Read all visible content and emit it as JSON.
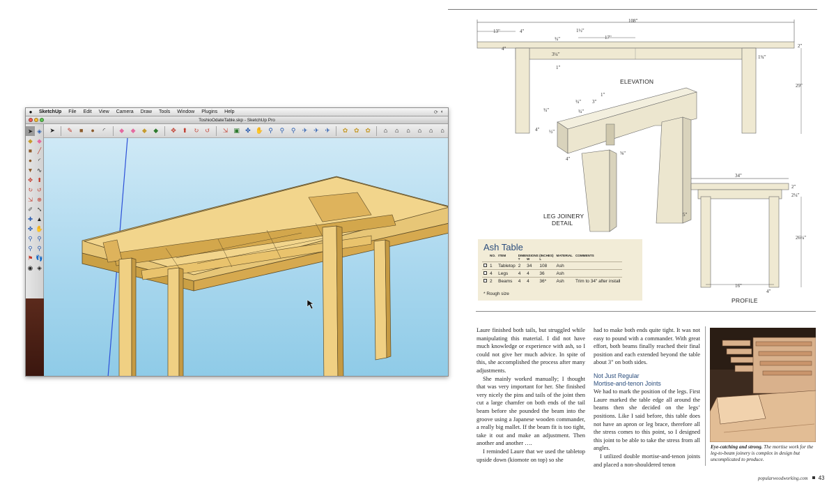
{
  "sketchup": {
    "menubar": {
      "apple": "",
      "items": [
        "SketchUp",
        "File",
        "Edit",
        "View",
        "Camera",
        "Draw",
        "Tools",
        "Window",
        "Plugins",
        "Help"
      ]
    },
    "window_title": "ToshioOdateTable.skp - SketchUp Pro",
    "traffic_lights": [
      "#ec5f57",
      "#f5be3a",
      "#5fc453"
    ],
    "toolbar_icons": [
      "select-arrow-icon",
      "pencil-icon",
      "rectangle-icon",
      "circle-icon",
      "arc-icon",
      "eraser-icon",
      "paint-bucket-icon",
      "tape-icon",
      "move-icon",
      "rotate-icon",
      "scale-icon",
      "push-pull-icon",
      "offset-icon",
      "follow-me-icon",
      "orbit-icon",
      "pan-icon",
      "zoom-icon",
      "zoom-window-icon",
      "zoom-extents-icon",
      "previous-view-icon",
      "next-view-icon",
      "position-camera-icon",
      "walk-icon",
      "look-around-icon",
      "section-plane-icon",
      "component-icon",
      "materials-icon",
      "views-icon"
    ],
    "palette_icons": [
      "select-icon",
      "component-icon",
      "paint-icon",
      "eraser-icon",
      "rectangle-icon",
      "line-icon",
      "circle-icon",
      "arc-icon",
      "polygon-icon",
      "freehand-icon",
      "move-icon",
      "push-pull-icon",
      "rotate-icon",
      "follow-me-icon",
      "scale-icon",
      "offset-icon",
      "tape-icon",
      "dimension-icon",
      "protractor-icon",
      "text-icon",
      "axes-icon",
      "3d-text-icon",
      "orbit-icon",
      "pan-icon",
      "zoom-icon",
      "zoom-window-icon",
      "zoom-extents-icon",
      "previous-icon",
      "position-camera-icon",
      "walk-icon",
      "look-around-icon",
      "section-icon"
    ]
  },
  "drawing": {
    "elevation": {
      "label": "ELEVATION",
      "dims": {
        "overall": "108\"",
        "d13": "13\"",
        "d4": "4\"",
        "d1_1_2": "1½\"",
        "d17": "17\"",
        "d3_4": "¾\"",
        "d3_1_4": "3¼\"",
        "d1": "1\"",
        "d4b": "4\"",
        "d2": "2\"",
        "d1_3_4": "1¾\"",
        "d29": "29\""
      }
    },
    "detail": {
      "label_line1": "LEG JOINERY",
      "label_line2": "DETAIL",
      "dims": {
        "d3_4a": "¾\"",
        "d1": "1\"",
        "d3_4b": "¾\"",
        "d3": "3\"",
        "d3_4c": "¾\"",
        "d4a": "4\"",
        "d1_2": "½\"",
        "d4b": "4\"",
        "d5_8": "⅝\""
      }
    },
    "profile": {
      "label": "PROFILE",
      "dims": {
        "d34": "34\"",
        "d2": "2\"",
        "d2_1_4": "2¼\"",
        "d5": "5\"",
        "d26_1_4": "26¼\"",
        "d16": "16\"",
        "d4": "4\""
      }
    }
  },
  "cutlist": {
    "title": "Ash Table",
    "headers": {
      "no": "NO.",
      "item": "ITEM",
      "dims": "DIMENSIONS (INCHES)",
      "material": "MATERIAL",
      "comments": "COMMENTS",
      "t": "T",
      "w": "W",
      "l": "L"
    },
    "rows": [
      {
        "no": "1",
        "item": "Tabletop",
        "t": "2",
        "w": "34",
        "l": "108",
        "material": "Ash",
        "comments": ""
      },
      {
        "no": "4",
        "item": "Legs",
        "t": "4",
        "w": "4",
        "l": "36",
        "material": "Ash",
        "comments": ""
      },
      {
        "no": "2",
        "item": "Beams",
        "t": "4",
        "w": "4",
        "l": "36*",
        "material": "Ash",
        "comments": "Trim to 34\" after install"
      }
    ],
    "footnote": "* Rough size"
  },
  "article": {
    "col1": [
      "Laure finished both tails, but struggled while manipulating this material. I did not have much knowledge or experience with ash, so I could not give her much advice. In spite of this, she accomplished the process after many adjustments.",
      "She mainly worked manually; I thought that was very important for her. She finished very nicely the pins and tails of the joint then cut a large chamfer on both ends of the tail beam before she pounded the beam into the groove using a Japanese wooden commander, a really big mallet. If the beam fit is too tight, take it out and make an adjustment. Then another and another ….",
      "I reminded Laure that we used the tabletop upside down (kiomote on top) so she"
    ],
    "col2_intro": "had to make both ends quite tight. It was not easy to pound with a commander. With great effort, both beams finally reached their final position and each extended beyond the table about 3\" on both sides.",
    "col2_heading_line1": "Not Just Regular",
    "col2_heading_line2": "Mortise-and-tenon Joints",
    "col2_body": [
      "We had to mark the position of the legs. First Laure marked the table edge all around the beams then she decided on the legs’ positions. Like I said before, this table does not have an apron or leg brace, therefore all the stress comes to this point, so I designed this joint to be able to take the stress from all angles.",
      "I utilized double mortise-and-tenon joints and placed a non-shouldered tenon"
    ],
    "caption_bold": "Eye-catching and strong.",
    "caption_text": " The mortise work for the leg-to-beam joinery is complex in design but uncomplicated to produce."
  },
  "footer": {
    "site": "popularwoodworking.com",
    "page": "43"
  },
  "colors": {
    "accent_blue": "#2b4d7c",
    "cutlist_bg": "#f2ecd7",
    "wood": "#f2d58c",
    "drawing_wood": "#efe9d2"
  }
}
